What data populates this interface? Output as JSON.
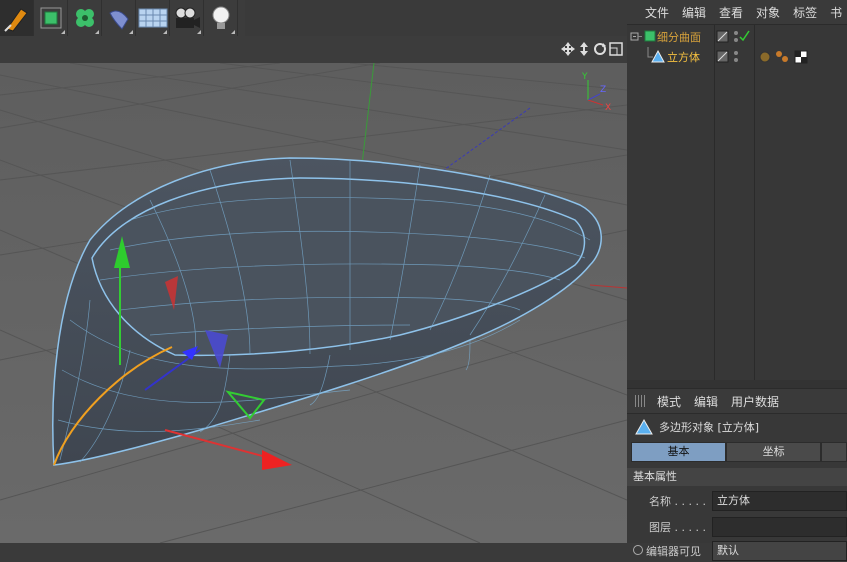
{
  "toolbar": {
    "tools": [
      "pen-tool-icon",
      "cube-icon",
      "cloner-icon",
      "deformer-icon",
      "floor-icon",
      "camera-icon",
      "light-icon"
    ]
  },
  "viewport": {
    "axis_labels": {
      "y": "Y",
      "z": "Z",
      "x": "X"
    }
  },
  "object_manager": {
    "menu": [
      "文件",
      "编辑",
      "查看",
      "对象",
      "标签",
      "书"
    ],
    "objects": [
      {
        "name": "细分曲面",
        "color": "#d7a23b"
      },
      {
        "name": "立方体",
        "color": "#f5c040"
      }
    ]
  },
  "attributes": {
    "menu": [
      "模式",
      "编辑",
      "用户数据"
    ],
    "object_title": "多边形对象 [立方体]",
    "tabs": [
      "基本",
      "坐标"
    ],
    "section": "基本属性",
    "fields": [
      {
        "label": "名称 . . . . .",
        "value": "立方体"
      },
      {
        "label": "图层 . . . . .",
        "value": ""
      },
      {
        "label": "编辑器可见",
        "value": "默认"
      }
    ]
  },
  "colors": {
    "accent": "#7e9ec2",
    "selection": "#f0a020",
    "wire": "#7ab6e0"
  }
}
